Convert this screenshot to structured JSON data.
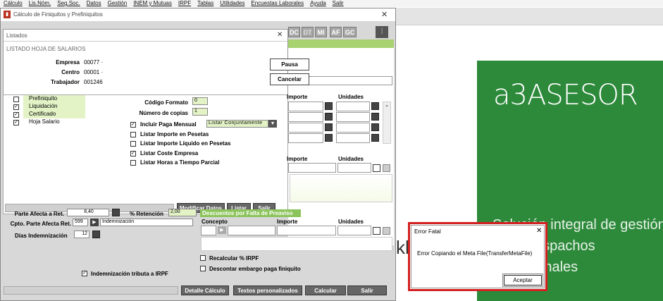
{
  "menu": [
    "Cálculo",
    "Lis.Nóm.",
    "Seg.Soc.",
    "Datos",
    "Gestión",
    "INEM y Mutuas",
    "IRPF",
    "Tablas",
    "Utilidades",
    "Encuestas Laborales",
    "Ayuda",
    "Salir"
  ],
  "background": {
    "logo": "a3ASESOR",
    "tagline": "Solución integral de gestión para Despachos Profesionales",
    "partial_text": "kl"
  },
  "window": {
    "title": "Cálculo de Finiquitos y Prefiniquitos",
    "icon": "app-icon",
    "toolbar_buttons": [
      "DC",
      "DT",
      "MI",
      "AF",
      "GC"
    ]
  },
  "listados": {
    "title": "Listados",
    "heading": "LISTADO HOJA DE SALARIOS",
    "empresa_label": "Empresa",
    "empresa_value": "00077 ·",
    "centro_label": "Centro",
    "centro_value": "00001 ·",
    "trabajador_label": "Trabajador",
    "trabajador_value": "001246",
    "pausa": "Pausa",
    "cancelar": "Cancelar"
  },
  "form": {
    "doc_types": [
      {
        "label": "Prefiniquito",
        "checked": false
      },
      {
        "label": "Liquidación",
        "checked": true
      },
      {
        "label": "Certificado",
        "checked": true
      },
      {
        "label": "Hoja Salario",
        "checked": true
      }
    ],
    "codigo_formato_label": "Código Formato",
    "codigo_formato_value": "0",
    "num_copias_label": "Número de copias",
    "num_copias_value": "1",
    "options": [
      {
        "label": "Incluir Paga Mensual",
        "checked": true
      },
      {
        "label": "Listar Importe en Pesetas",
        "checked": false
      },
      {
        "label": "Listar Importe Líquido en Pesetas",
        "checked": false
      },
      {
        "label": "Listar Coste Empresa",
        "checked": true
      },
      {
        "label": "Listar Horas a Tiempo Parcial",
        "checked": false
      }
    ],
    "paga_select": "Listar Conjuntamente",
    "buttons": [
      "Modificar Datos",
      "Listar",
      "Salir"
    ]
  },
  "grid": {
    "importe": "Importe",
    "unidades": "Unidades",
    "concepto": "Concepto"
  },
  "lower": {
    "parte_afecta_label": "Parte Afecta a Ret.",
    "parte_afecta_value": "8,40",
    "retencion_label": "% Retención",
    "retencion_value": "2,00",
    "cpto_label": "Cpto. Parte Afecta Ret.",
    "cpto_value": "599",
    "cpto_desc": "Indemnización",
    "dias_label": "Días Indemnización",
    "dias_value": "12",
    "descuentos_title": "Descuentos por Falta de Preaviso",
    "recalcular_label": "Recalcular % IRPF",
    "descontar_label": "Descontar embargo paga finiquito",
    "indemnizacion_irpf_label": "Indemnización tributa a IRPF",
    "indemnizacion_irpf_checked": true
  },
  "bottom_buttons": [
    "Detalle Cálculo",
    "Textos personalizados",
    "Calcular",
    "Salir"
  ],
  "error_dialog": {
    "title": "Error Fatal",
    "message": "Error Copiando el Meta File(TransferMetaFile)",
    "button": "Aceptar"
  }
}
